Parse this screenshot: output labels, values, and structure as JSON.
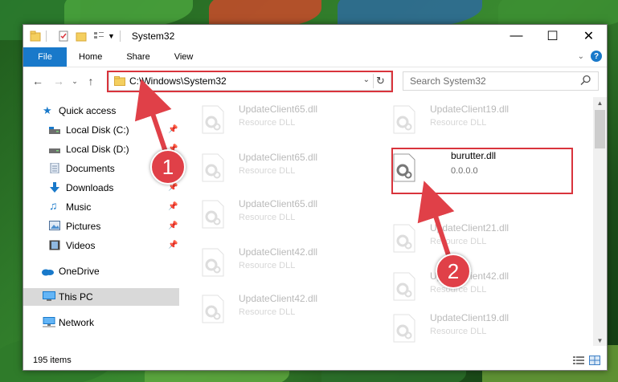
{
  "window": {
    "title": "System32"
  },
  "ribbon": {
    "file_label": "File",
    "tabs": [
      "Home",
      "Share",
      "View"
    ]
  },
  "navigation": {
    "address": "C:\\Windows\\System32",
    "search_placeholder": "Search System32"
  },
  "sidebar": {
    "items": [
      {
        "label": "Quick access",
        "icon": "star-icon",
        "pinned": false
      },
      {
        "label": "Local Disk (C:)",
        "icon": "drive-icon",
        "pinned": true
      },
      {
        "label": "Local Disk (D:)",
        "icon": "drive-icon",
        "pinned": true
      },
      {
        "label": "Documents",
        "icon": "documents-icon",
        "pinned": true
      },
      {
        "label": "Downloads",
        "icon": "download-icon",
        "pinned": true
      },
      {
        "label": "Music",
        "icon": "music-icon",
        "pinned": true
      },
      {
        "label": "Pictures",
        "icon": "pictures-icon",
        "pinned": true
      },
      {
        "label": "Videos",
        "icon": "videos-icon",
        "pinned": true
      },
      {
        "label": "OneDrive",
        "icon": "cloud-icon",
        "pinned": false
      },
      {
        "label": "This PC",
        "icon": "computer-icon",
        "pinned": false,
        "selected": true
      },
      {
        "label": "Network",
        "icon": "network-icon",
        "pinned": false
      }
    ]
  },
  "files": {
    "left_column": [
      {
        "name": "UpdateClient65.dll",
        "sub": "Resource DLL"
      },
      {
        "name": "UpdateClient65.dll",
        "sub": "Resource DLL"
      },
      {
        "name": "UpdateClient65.dll",
        "sub": "Resource DLL"
      },
      {
        "name": "UpdateClient42.dll",
        "sub": "Resource DLL"
      },
      {
        "name": "UpdateClient42.dll",
        "sub": "Resource DLL"
      }
    ],
    "right_column": [
      {
        "name": "UpdateClient19.dll",
        "sub": "Resource DLL"
      },
      {
        "name": "UpdateClient21.dll",
        "sub": "Resource DLL"
      },
      {
        "name": "UpdateClient42.dll",
        "sub": "Resource DLL"
      },
      {
        "name": "UpdateClient19.dll",
        "sub": "Resource DLL"
      }
    ],
    "highlighted": {
      "name": "burutter.dll",
      "sub": "0.0.0.0"
    }
  },
  "status": {
    "item_count": "195 items"
  },
  "annotations": {
    "step1": "1",
    "step2": "2"
  },
  "colors": {
    "accent": "#1979ca",
    "highlight": "#d9343c"
  }
}
